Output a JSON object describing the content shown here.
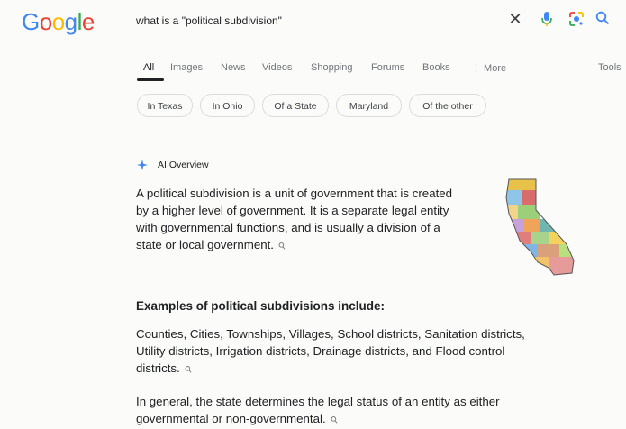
{
  "logo": {
    "letters": [
      "G",
      "o",
      "o",
      "g",
      "l",
      "e"
    ]
  },
  "search": {
    "query": "what is a \"political subdivision\"",
    "clear_symbol": "✕"
  },
  "tabs": [
    {
      "label": "All",
      "active": true
    },
    {
      "label": "Images"
    },
    {
      "label": "News"
    },
    {
      "label": "Videos"
    },
    {
      "label": "Shopping"
    },
    {
      "label": "Forums"
    },
    {
      "label": "Books"
    },
    {
      "label": "⋮ More"
    }
  ],
  "tools_label": "Tools",
  "chips": [
    "In Texas",
    "In Ohio",
    "Of a State",
    "Maryland",
    "Of the other"
  ],
  "ai_overview": {
    "title": "AI Overview",
    "intro": [
      "A political subdivision is a unit of government that is created",
      "by a higher level of government. It is a separate legal entity",
      "with governmental functions, and is usually a division of a",
      "state or local government."
    ],
    "examples_heading": "Examples of political subdivisions include:",
    "examples": [
      "Counties, Cities, Townships, Villages, School districts, Sanitation districts,",
      "Utility districts, Irrigation districts, Drainage districts, and Flood control",
      "districts."
    ],
    "conclusion": [
      "In general, the state determines the legal status of an entity as either",
      "governmental or non-governmental."
    ],
    "link_symbol": "⚲"
  },
  "colors": {
    "blue": "#4285f4",
    "red": "#ea4335",
    "yellow": "#fbbc05",
    "green": "#34a853",
    "text": "#202124",
    "muted": "#70757a"
  },
  "icons": [
    "close-icon",
    "microphone-icon",
    "google-lens-icon",
    "search-icon",
    "sparkle-icon",
    "link-icon",
    "california-map-image"
  ]
}
